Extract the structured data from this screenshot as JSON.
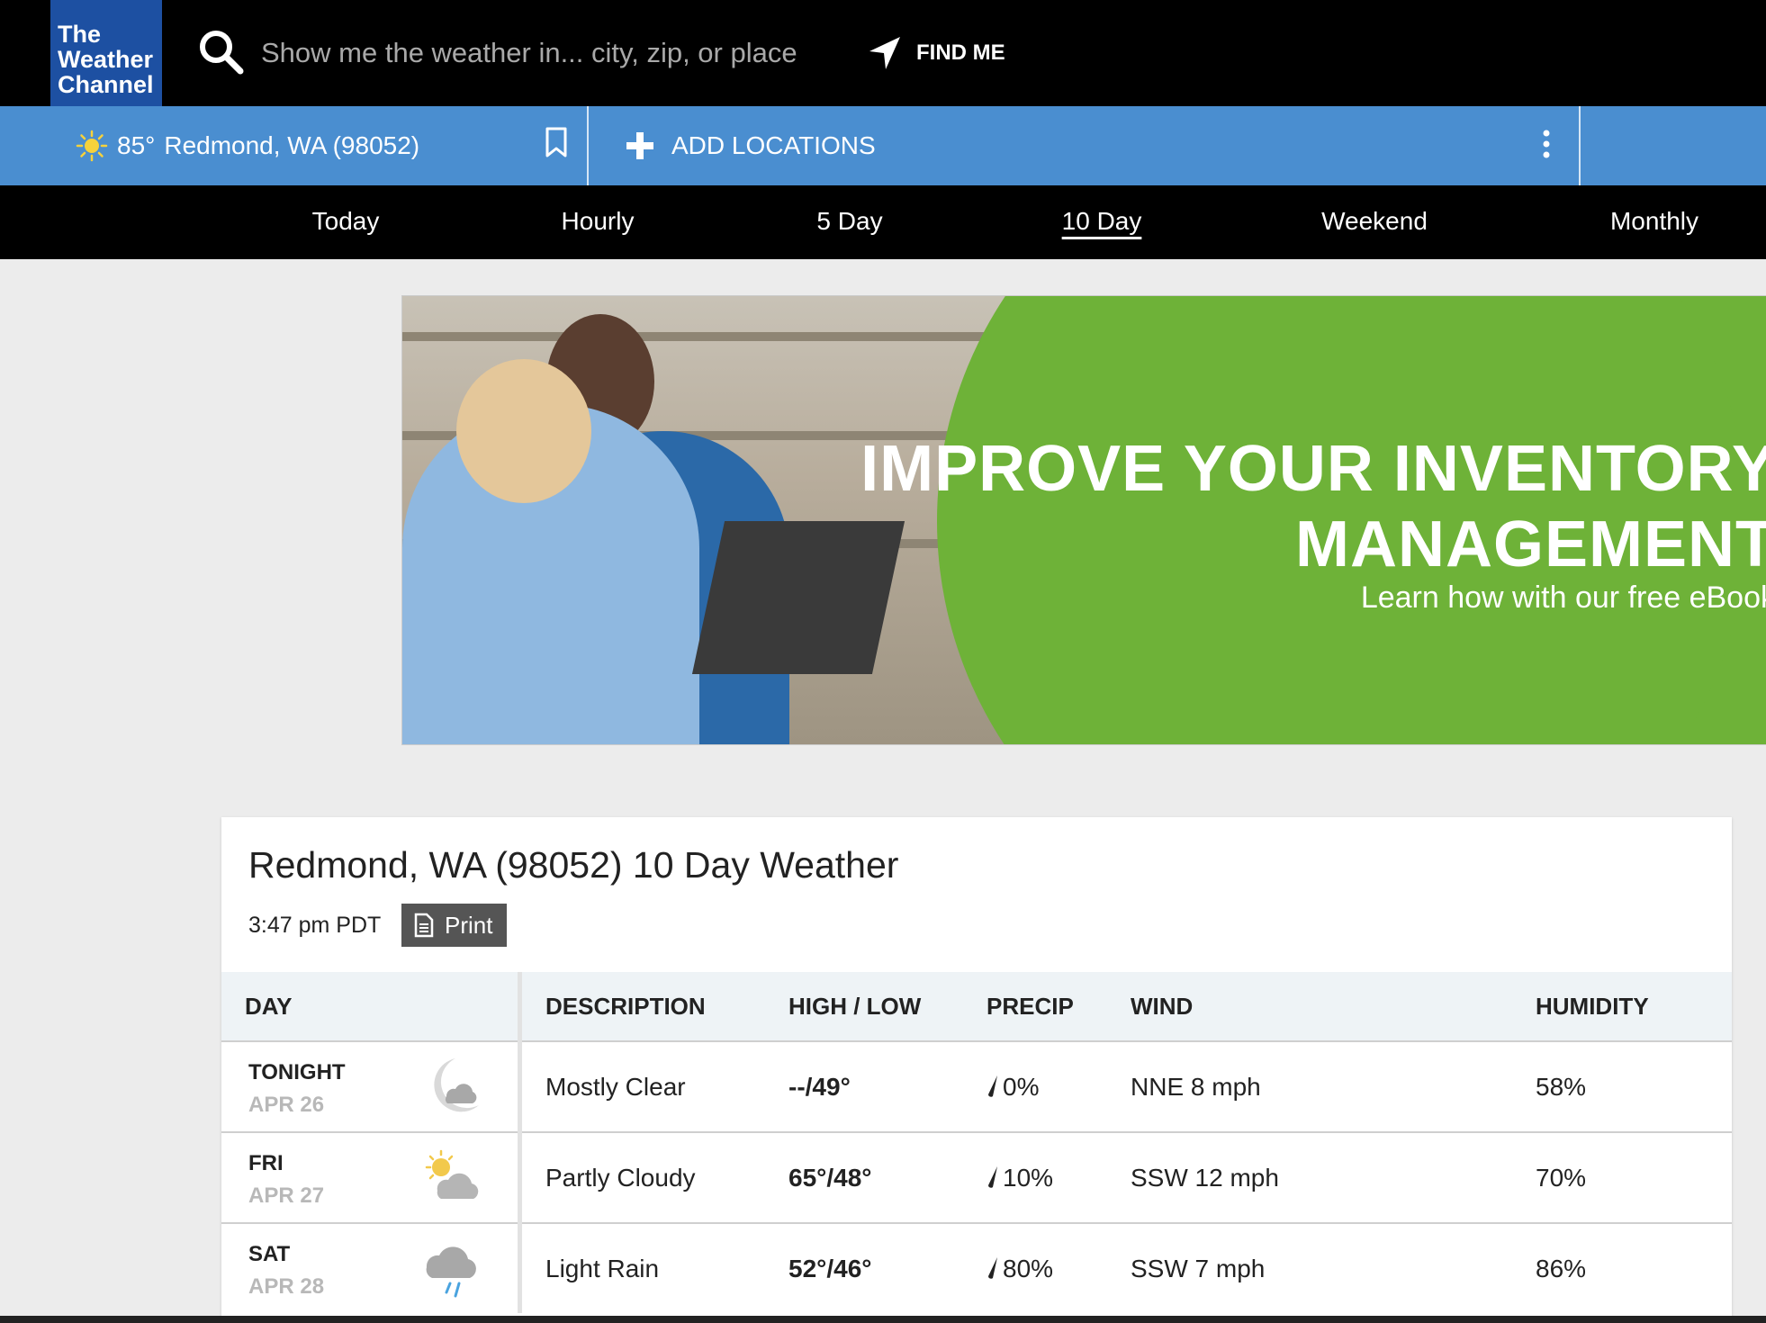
{
  "brand": {
    "logo_lines": [
      "The",
      "Weather",
      "Channel"
    ]
  },
  "search": {
    "placeholder": "Show me the weather in... city, zip, or place",
    "find_me_label": "FIND ME"
  },
  "location_bar": {
    "current_temp": "85°",
    "current_location": "Redmond, WA (98052)",
    "add_locations_label": "ADD LOCATIONS"
  },
  "nav_tabs": [
    {
      "label": "Today",
      "active": false
    },
    {
      "label": "Hourly",
      "active": false
    },
    {
      "label": "5 Day",
      "active": false
    },
    {
      "label": "10 Day",
      "active": true
    },
    {
      "label": "Weekend",
      "active": false
    },
    {
      "label": "Monthly",
      "active": false
    }
  ],
  "ad": {
    "headline_line1": "IMPROVE YOUR INVENTORY",
    "headline_line2": "MANAGEMENT",
    "subline": "Learn how with our free eBook"
  },
  "forecast": {
    "title": "Redmond, WA (98052) 10 Day Weather",
    "timestamp": "3:47 pm PDT",
    "print_label": "Print",
    "columns": [
      "DAY",
      "DESCRIPTION",
      "HIGH / LOW",
      "PRECIP",
      "WIND",
      "HUMIDITY"
    ],
    "rows": [
      {
        "day": "TONIGHT",
        "date": "APR 26",
        "icon": "moon-cloud-icon",
        "description": "Mostly Clear",
        "high_low": "--/49°",
        "precip": "0%",
        "wind": "NNE 8 mph",
        "humidity": "58%"
      },
      {
        "day": "FRI",
        "date": "APR 27",
        "icon": "partly-cloudy-icon",
        "description": "Partly Cloudy",
        "high_low": "65°/48°",
        "precip": "10%",
        "wind": "SSW 12 mph",
        "humidity": "70%"
      },
      {
        "day": "SAT",
        "date": "APR 28",
        "icon": "rain-cloud-icon",
        "description": "Light Rain",
        "high_low": "52°/46°",
        "precip": "80%",
        "wind": "SSW 7 mph",
        "humidity": "86%"
      }
    ]
  },
  "colors": {
    "brand_blue": "#1d50a2",
    "location_bar": "#4a8ed0",
    "ad_green": "#6eb238"
  }
}
